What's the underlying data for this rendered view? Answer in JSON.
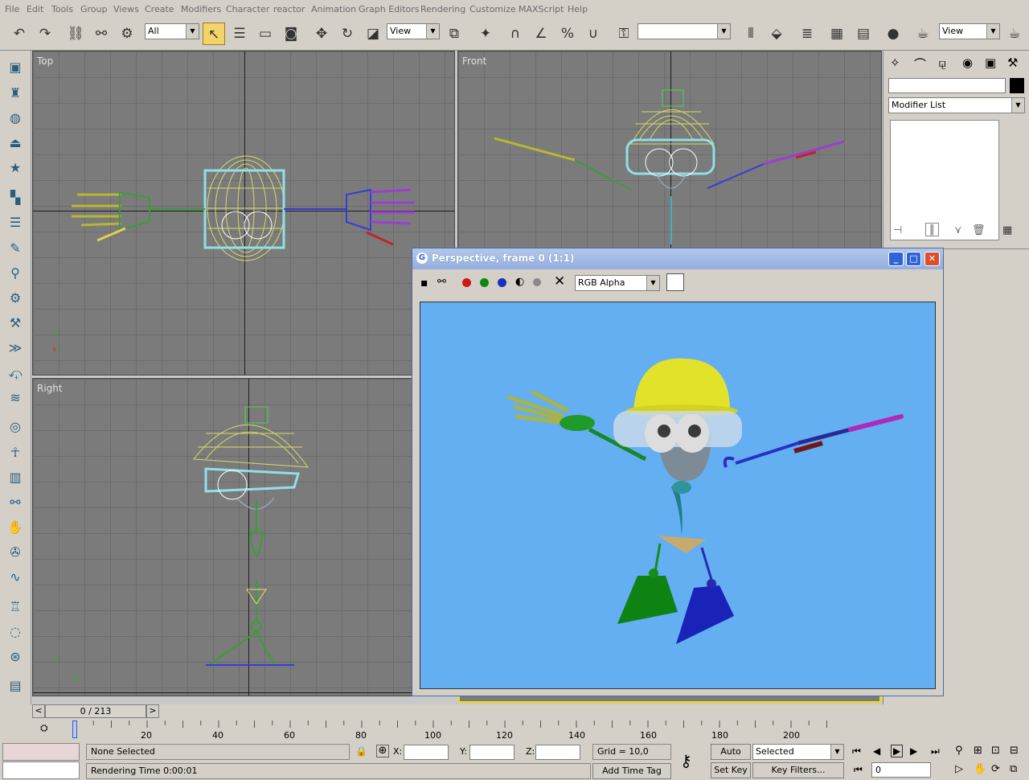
{
  "menu": [
    "File",
    "Edit",
    "Tools",
    "Group",
    "Views",
    "Create",
    "Modifiers",
    "Character",
    "reactor",
    "Animation",
    "Graph Editors",
    "Rendering",
    "Customize",
    "MAXScript",
    "Help"
  ],
  "toolbar": {
    "selection_filter": "All",
    "ref_coord": "View",
    "named_selection": "",
    "render_view": "View"
  },
  "viewports": {
    "top": "Top",
    "front": "Front",
    "right": "Right"
  },
  "command_panel": {
    "name_field": "",
    "modifier_list": "Modifier List"
  },
  "render_window": {
    "title": "Perspective, frame 0 (1:1)",
    "channel": "RGB Alpha",
    "bg_color": "#64aef2"
  },
  "timeline": {
    "slider": "0 / 213",
    "ticks": [
      "20",
      "40",
      "60",
      "80",
      "100",
      "120",
      "140",
      "160",
      "180",
      "200"
    ]
  },
  "status": {
    "selection": "None Selected",
    "render_time": "Rendering Time  0:00:01",
    "x_label": "X:",
    "y_label": "Y:",
    "z_label": "Z:",
    "grid": "Grid = 10,0",
    "add_time_tag": "Add Time Tag",
    "auto_key": "Auto Key",
    "set_key": "Set Key",
    "selected": "Selected",
    "key_filters": "Key Filters...",
    "frame": "0"
  }
}
